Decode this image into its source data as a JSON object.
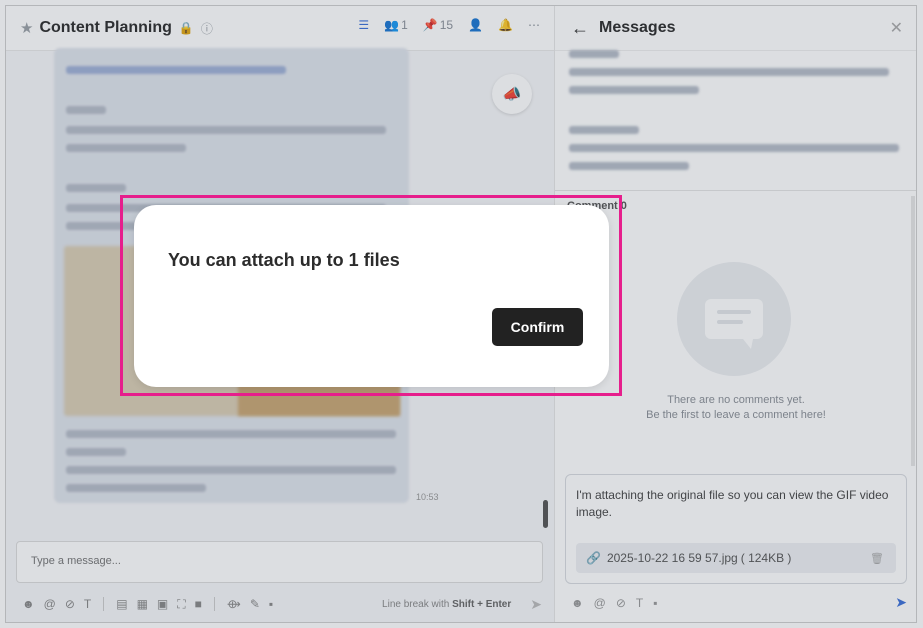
{
  "chat": {
    "title": "Content Planning",
    "header_icons": [
      "task-list-icon",
      "members-icon",
      "pins-icon",
      "add-member-icon",
      "notifications-icon",
      "more-icon"
    ],
    "member_count": "1",
    "pin_count": "15",
    "timestamp": "10:53",
    "composer_placeholder": "Type a message...",
    "hint_prefix": "Line break with ",
    "hint_keys": "Shift + Enter"
  },
  "side": {
    "title": "Messages",
    "comment_label": "Comment 0",
    "empty_line1": "There are no comments yet.",
    "empty_line2": "Be the first to leave a comment here!",
    "reply_text": "I'm attaching the original file so you can view the GIF video image.",
    "attachment_name": "2025-10-22 16 59 57.jpg",
    "attachment_size": "( 124KB )"
  },
  "dialog": {
    "message": "You can attach up to 1 files",
    "confirm_label": "Confirm"
  },
  "colors": {
    "accent": "#3b6fd8",
    "highlight": "#e61e8c",
    "dialog_button": "#222222"
  }
}
